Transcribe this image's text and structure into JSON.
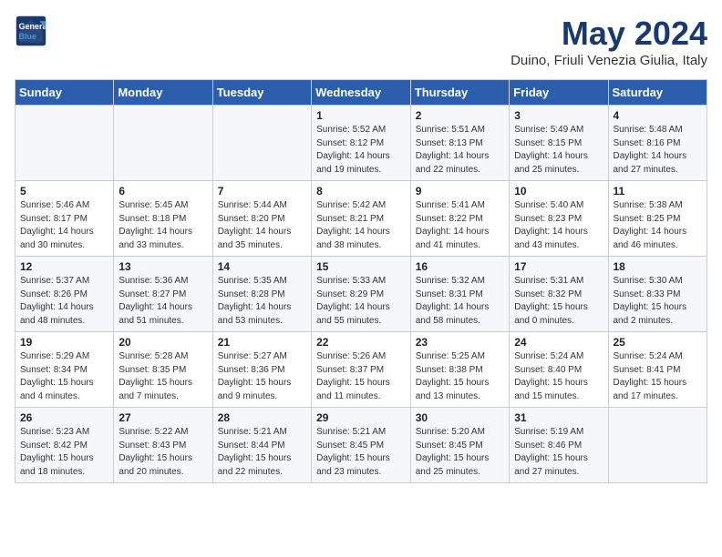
{
  "header": {
    "logo_line1": "General",
    "logo_line2": "Blue",
    "title": "May 2024",
    "location": "Duino, Friuli Venezia Giulia, Italy"
  },
  "weekdays": [
    "Sunday",
    "Monday",
    "Tuesday",
    "Wednesday",
    "Thursday",
    "Friday",
    "Saturday"
  ],
  "weeks": [
    [
      {
        "day": "",
        "info": ""
      },
      {
        "day": "",
        "info": ""
      },
      {
        "day": "",
        "info": ""
      },
      {
        "day": "1",
        "info": "Sunrise: 5:52 AM\nSunset: 8:12 PM\nDaylight: 14 hours\nand 19 minutes."
      },
      {
        "day": "2",
        "info": "Sunrise: 5:51 AM\nSunset: 8:13 PM\nDaylight: 14 hours\nand 22 minutes."
      },
      {
        "day": "3",
        "info": "Sunrise: 5:49 AM\nSunset: 8:15 PM\nDaylight: 14 hours\nand 25 minutes."
      },
      {
        "day": "4",
        "info": "Sunrise: 5:48 AM\nSunset: 8:16 PM\nDaylight: 14 hours\nand 27 minutes."
      }
    ],
    [
      {
        "day": "5",
        "info": "Sunrise: 5:46 AM\nSunset: 8:17 PM\nDaylight: 14 hours\nand 30 minutes."
      },
      {
        "day": "6",
        "info": "Sunrise: 5:45 AM\nSunset: 8:18 PM\nDaylight: 14 hours\nand 33 minutes."
      },
      {
        "day": "7",
        "info": "Sunrise: 5:44 AM\nSunset: 8:20 PM\nDaylight: 14 hours\nand 35 minutes."
      },
      {
        "day": "8",
        "info": "Sunrise: 5:42 AM\nSunset: 8:21 PM\nDaylight: 14 hours\nand 38 minutes."
      },
      {
        "day": "9",
        "info": "Sunrise: 5:41 AM\nSunset: 8:22 PM\nDaylight: 14 hours\nand 41 minutes."
      },
      {
        "day": "10",
        "info": "Sunrise: 5:40 AM\nSunset: 8:23 PM\nDaylight: 14 hours\nand 43 minutes."
      },
      {
        "day": "11",
        "info": "Sunrise: 5:38 AM\nSunset: 8:25 PM\nDaylight: 14 hours\nand 46 minutes."
      }
    ],
    [
      {
        "day": "12",
        "info": "Sunrise: 5:37 AM\nSunset: 8:26 PM\nDaylight: 14 hours\nand 48 minutes."
      },
      {
        "day": "13",
        "info": "Sunrise: 5:36 AM\nSunset: 8:27 PM\nDaylight: 14 hours\nand 51 minutes."
      },
      {
        "day": "14",
        "info": "Sunrise: 5:35 AM\nSunset: 8:28 PM\nDaylight: 14 hours\nand 53 minutes."
      },
      {
        "day": "15",
        "info": "Sunrise: 5:33 AM\nSunset: 8:29 PM\nDaylight: 14 hours\nand 55 minutes."
      },
      {
        "day": "16",
        "info": "Sunrise: 5:32 AM\nSunset: 8:31 PM\nDaylight: 14 hours\nand 58 minutes."
      },
      {
        "day": "17",
        "info": "Sunrise: 5:31 AM\nSunset: 8:32 PM\nDaylight: 15 hours\nand 0 minutes."
      },
      {
        "day": "18",
        "info": "Sunrise: 5:30 AM\nSunset: 8:33 PM\nDaylight: 15 hours\nand 2 minutes."
      }
    ],
    [
      {
        "day": "19",
        "info": "Sunrise: 5:29 AM\nSunset: 8:34 PM\nDaylight: 15 hours\nand 4 minutes."
      },
      {
        "day": "20",
        "info": "Sunrise: 5:28 AM\nSunset: 8:35 PM\nDaylight: 15 hours\nand 7 minutes."
      },
      {
        "day": "21",
        "info": "Sunrise: 5:27 AM\nSunset: 8:36 PM\nDaylight: 15 hours\nand 9 minutes."
      },
      {
        "day": "22",
        "info": "Sunrise: 5:26 AM\nSunset: 8:37 PM\nDaylight: 15 hours\nand 11 minutes."
      },
      {
        "day": "23",
        "info": "Sunrise: 5:25 AM\nSunset: 8:38 PM\nDaylight: 15 hours\nand 13 minutes."
      },
      {
        "day": "24",
        "info": "Sunrise: 5:24 AM\nSunset: 8:40 PM\nDaylight: 15 hours\nand 15 minutes."
      },
      {
        "day": "25",
        "info": "Sunrise: 5:24 AM\nSunset: 8:41 PM\nDaylight: 15 hours\nand 17 minutes."
      }
    ],
    [
      {
        "day": "26",
        "info": "Sunrise: 5:23 AM\nSunset: 8:42 PM\nDaylight: 15 hours\nand 18 minutes."
      },
      {
        "day": "27",
        "info": "Sunrise: 5:22 AM\nSunset: 8:43 PM\nDaylight: 15 hours\nand 20 minutes."
      },
      {
        "day": "28",
        "info": "Sunrise: 5:21 AM\nSunset: 8:44 PM\nDaylight: 15 hours\nand 22 minutes."
      },
      {
        "day": "29",
        "info": "Sunrise: 5:21 AM\nSunset: 8:45 PM\nDaylight: 15 hours\nand 23 minutes."
      },
      {
        "day": "30",
        "info": "Sunrise: 5:20 AM\nSunset: 8:45 PM\nDaylight: 15 hours\nand 25 minutes."
      },
      {
        "day": "31",
        "info": "Sunrise: 5:19 AM\nSunset: 8:46 PM\nDaylight: 15 hours\nand 27 minutes."
      },
      {
        "day": "",
        "info": ""
      }
    ]
  ]
}
